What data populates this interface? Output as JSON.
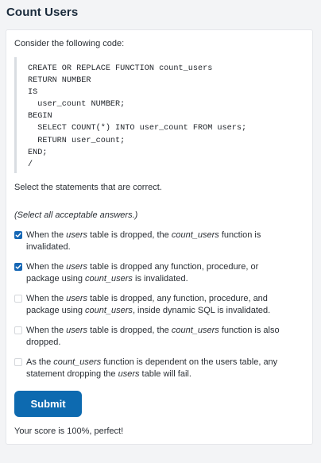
{
  "page": {
    "title": "Count Users"
  },
  "question": {
    "prompt": "Consider the following code:",
    "code_lines": [
      "CREATE OR REPLACE FUNCTION count_users",
      "RETURN NUMBER",
      "IS",
      "  user_count NUMBER;",
      "BEGIN",
      "  SELECT COUNT(*) INTO user_count FROM users;",
      "  RETURN user_count;",
      "END;",
      "/"
    ],
    "instruction": "Select the statements that are correct.",
    "hint": "(Select all acceptable answers.)"
  },
  "options": [
    {
      "checked": true,
      "parts": [
        {
          "t": "When the ",
          "i": false
        },
        {
          "t": "users",
          "i": true
        },
        {
          "t": " table is dropped, the ",
          "i": false
        },
        {
          "t": "count_users",
          "i": true
        },
        {
          "t": " function is invalidated.",
          "i": false
        }
      ]
    },
    {
      "checked": true,
      "parts": [
        {
          "t": "When the ",
          "i": false
        },
        {
          "t": "users",
          "i": true
        },
        {
          "t": " table is dropped any function, procedure, or package using ",
          "i": false
        },
        {
          "t": "count_users",
          "i": true
        },
        {
          "t": " is invalidated.",
          "i": false
        }
      ]
    },
    {
      "checked": false,
      "parts": [
        {
          "t": "When the ",
          "i": false
        },
        {
          "t": "users",
          "i": true
        },
        {
          "t": " table is dropped, any function, procedure, and package using ",
          "i": false
        },
        {
          "t": "count_users",
          "i": true
        },
        {
          "t": ", inside dynamic SQL is invalidated.",
          "i": false
        }
      ]
    },
    {
      "checked": false,
      "parts": [
        {
          "t": "When the ",
          "i": false
        },
        {
          "t": "users",
          "i": true
        },
        {
          "t": " table is dropped, the ",
          "i": false
        },
        {
          "t": "count_users",
          "i": true
        },
        {
          "t": " function is also dropped.",
          "i": false
        }
      ]
    },
    {
      "checked": false,
      "parts": [
        {
          "t": "As the ",
          "i": false
        },
        {
          "t": "count_users",
          "i": true
        },
        {
          "t": " function is dependent on the users table, any statement dropping the ",
          "i": false
        },
        {
          "t": "users",
          "i": true
        },
        {
          "t": " table will fail.",
          "i": false
        }
      ]
    }
  ],
  "submit": {
    "label": "Submit"
  },
  "result": {
    "score_text": "Your score is 100%, perfect!"
  },
  "colors": {
    "accent": "#0d6ab0",
    "checkbox_checked": "#1667b5",
    "background": "#f3f4f6",
    "card": "#ffffff"
  },
  "icons": {
    "checked": "check-icon"
  }
}
